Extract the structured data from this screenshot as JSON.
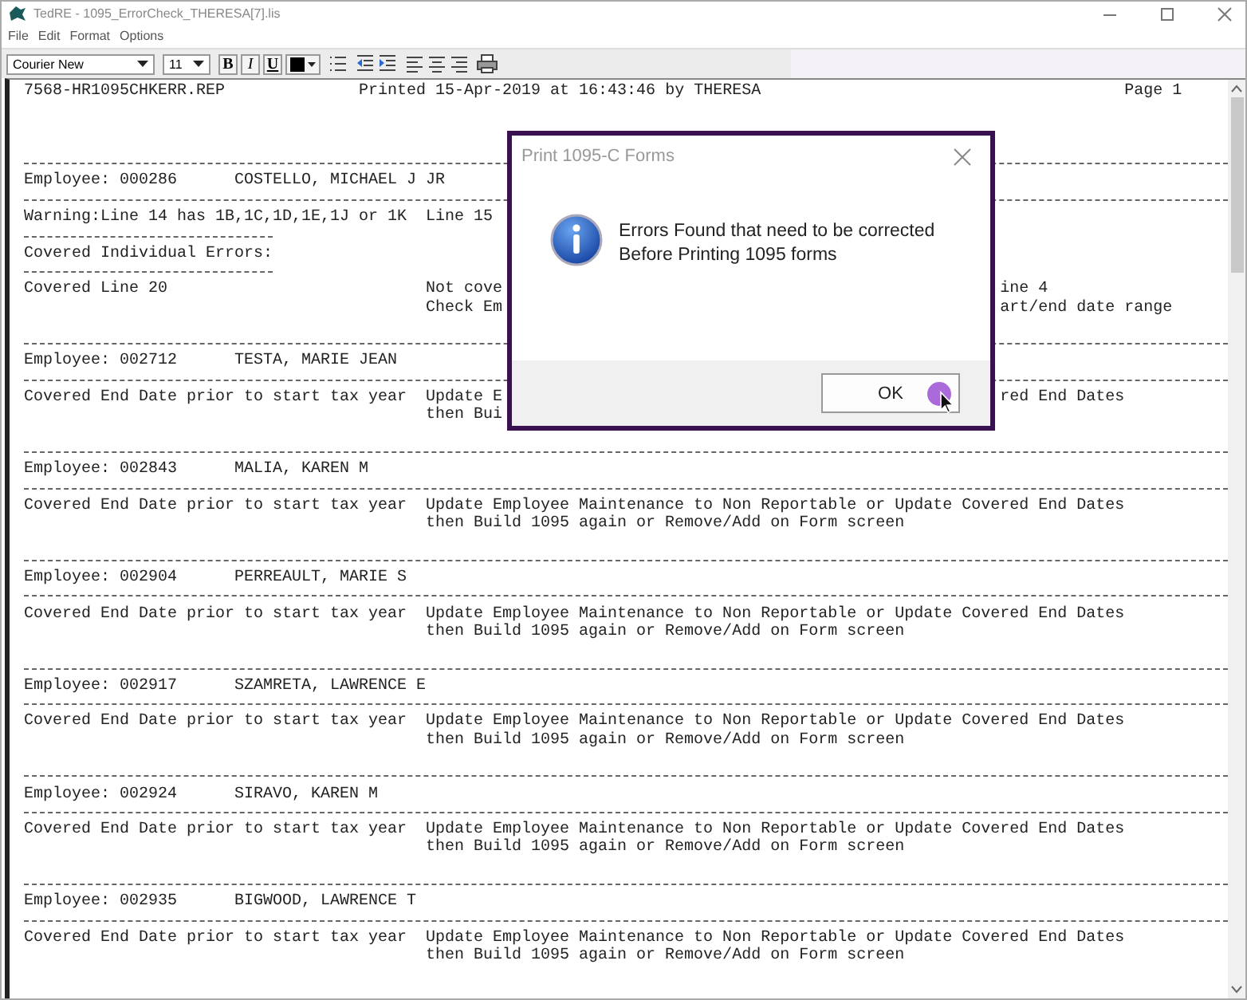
{
  "window": {
    "title": "TedRE - 1095_ErrorCheck_THERESA[7].lis"
  },
  "menu": [
    "File",
    "Edit",
    "Format",
    "Options"
  ],
  "toolbar": {
    "font": "Courier New",
    "size": "11",
    "format_buttons": [
      {
        "label": "B",
        "kind": "bold"
      },
      {
        "label": "I",
        "kind": "italic"
      },
      {
        "label": "U",
        "kind": "underline"
      }
    ]
  },
  "document": {
    "lines": [
      {
        "kind": "header",
        "left": "7568-HR1095CHKERR.REP",
        "middle": "Printed 15-Apr-2019 at 16:43:46 by THERESA",
        "right": "Page 1"
      },
      {
        "kind": "blank"
      },
      {
        "kind": "blank"
      },
      {
        "kind": "blank"
      },
      {
        "kind": "rule"
      },
      {
        "kind": "employee",
        "number": "Employee: 000286",
        "name": "COSTELLO, MICHAEL J JR"
      },
      {
        "kind": "rule"
      },
      {
        "kind": "text",
        "left": "Warning:Line 14 has 1B,1C,1D,1E,1J or 1K",
        "middle": "Line 15"
      },
      {
        "kind": "short_rule"
      },
      {
        "kind": "text",
        "left": "Covered Individual Errors:"
      },
      {
        "kind": "short_rule"
      },
      {
        "kind": "text",
        "left": "Covered Line 20",
        "middle": "Not cove",
        "right": "ine 4"
      },
      {
        "kind": "text",
        "middle": "Check Em",
        "right": "art/end date range"
      },
      {
        "kind": "blank"
      },
      {
        "kind": "rule"
      },
      {
        "kind": "employee",
        "number": "Employee: 002712",
        "name": "TESTA, MARIE JEAN"
      },
      {
        "kind": "rule"
      },
      {
        "kind": "text",
        "left": "Covered End Date prior to start tax year",
        "middle": "Update E",
        "right": "red End Dates"
      },
      {
        "kind": "text",
        "middle": "then Bui"
      },
      {
        "kind": "blank"
      },
      {
        "kind": "rule"
      },
      {
        "kind": "employee",
        "number": "Employee: 002843",
        "name": "MALIA, KAREN M"
      },
      {
        "kind": "rule"
      },
      {
        "kind": "text",
        "left": "Covered End Date prior to start tax year",
        "middle": "Update Employee Maintenance to Non Reportable or Update Covered End Dates"
      },
      {
        "kind": "text",
        "middle": "then Build 1095 again or Remove/Add on Form screen"
      },
      {
        "kind": "blank"
      },
      {
        "kind": "rule"
      },
      {
        "kind": "employee",
        "number": "Employee: 002904",
        "name": "PERREAULT, MARIE S"
      },
      {
        "kind": "rule"
      },
      {
        "kind": "text",
        "left": "Covered End Date prior to start tax year",
        "middle": "Update Employee Maintenance to Non Reportable or Update Covered End Dates"
      },
      {
        "kind": "text",
        "middle": "then Build 1095 again or Remove/Add on Form screen"
      },
      {
        "kind": "blank"
      },
      {
        "kind": "rule"
      },
      {
        "kind": "employee",
        "number": "Employee: 002917",
        "name": "SZAMRETA, LAWRENCE E"
      },
      {
        "kind": "rule"
      },
      {
        "kind": "text",
        "left": "Covered End Date prior to start tax year",
        "middle": "Update Employee Maintenance to Non Reportable or Update Covered End Dates"
      },
      {
        "kind": "text",
        "middle": "then Build 1095 again or Remove/Add on Form screen"
      },
      {
        "kind": "blank"
      },
      {
        "kind": "rule"
      },
      {
        "kind": "employee",
        "number": "Employee: 002924",
        "name": "SIRAVO, KAREN M"
      },
      {
        "kind": "rule"
      },
      {
        "kind": "text",
        "left": "Covered End Date prior to start tax year",
        "middle": "Update Employee Maintenance to Non Reportable or Update Covered End Dates"
      },
      {
        "kind": "text",
        "middle": "then Build 1095 again or Remove/Add on Form screen"
      },
      {
        "kind": "blank"
      },
      {
        "kind": "rule"
      },
      {
        "kind": "employee",
        "number": "Employee: 002935",
        "name": "BIGWOOD, LAWRENCE T"
      },
      {
        "kind": "rule"
      },
      {
        "kind": "text",
        "left": "Covered End Date prior to start tax year",
        "middle": "Update Employee Maintenance to Non Reportable or Update Covered End Dates"
      },
      {
        "kind": "text",
        "middle": "then Build 1095 again or Remove/Add on Form screen"
      }
    ]
  },
  "dialog": {
    "title": "Print 1095-C Forms",
    "message": "Errors Found that need to be corrected\nBefore Printing 1095 forms",
    "button": "OK"
  }
}
